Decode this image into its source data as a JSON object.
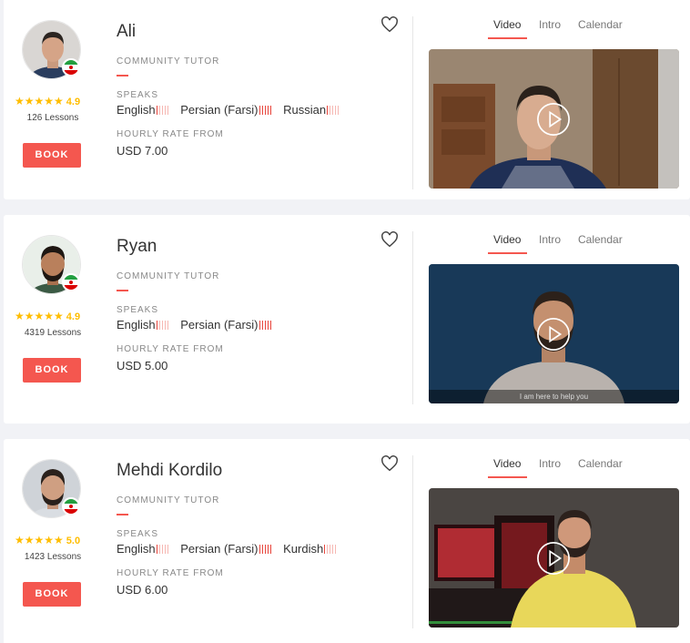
{
  "labels": {
    "community_tutor": "COMMUNITY TUTOR",
    "speaks": "SPEAKS",
    "hourly_rate_from": "HOURLY RATE FROM",
    "book": "BOOK",
    "tab_video": "Video",
    "tab_intro": "Intro",
    "tab_calendar": "Calendar"
  },
  "colors": {
    "accent": "#f4574f",
    "star": "#ffbd00"
  },
  "tutors": [
    {
      "name": "Ali",
      "stars": "★★★★★",
      "rating": "4.9",
      "lessons": "126 Lessons",
      "languages": [
        {
          "name": "English",
          "level": 1
        },
        {
          "name": "Persian (Farsi)",
          "level": 5
        },
        {
          "name": "Russian",
          "level": 1
        }
      ],
      "rate": "USD 7.00",
      "flag": "iran-flag-icon",
      "video_caption": ""
    },
    {
      "name": "Ryan",
      "stars": "★★★★★",
      "rating": "4.9",
      "lessons": "4319 Lessons",
      "languages": [
        {
          "name": "English",
          "level": 1
        },
        {
          "name": "Persian (Farsi)",
          "level": 5
        }
      ],
      "rate": "USD 5.00",
      "flag": "iran-flag-icon",
      "video_caption": "I am here to help you"
    },
    {
      "name": "Mehdi Kordilo",
      "stars": "★★★★★",
      "rating": "5.0",
      "lessons": "1423 Lessons",
      "languages": [
        {
          "name": "English",
          "level": 1
        },
        {
          "name": "Persian (Farsi)",
          "level": 5
        },
        {
          "name": "Kurdish",
          "level": 1
        }
      ],
      "rate": "USD 6.00",
      "flag": "iran-flag-icon",
      "video_caption": ""
    }
  ]
}
